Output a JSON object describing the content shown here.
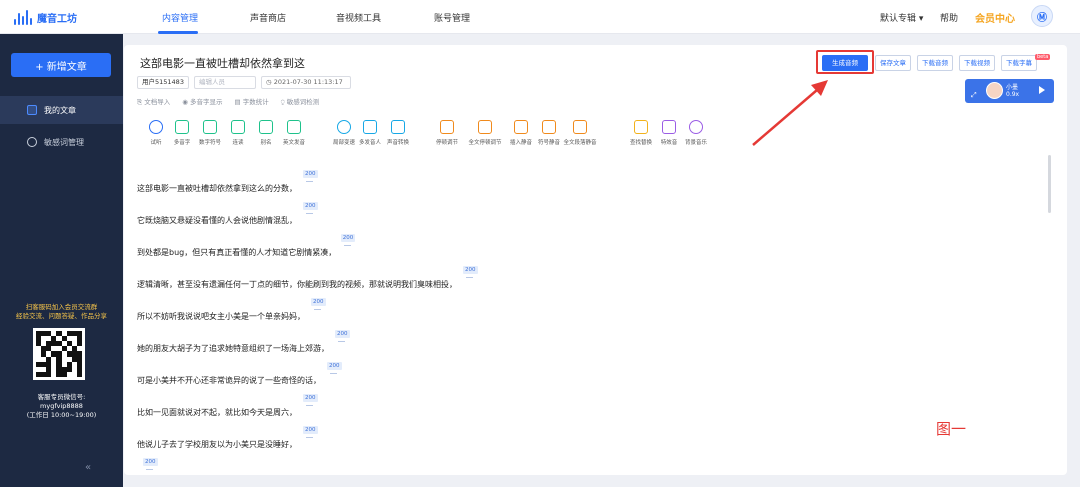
{
  "app": {
    "logo_text": "魔音工坊"
  },
  "nav": [
    "内容管理",
    "声音商店",
    "音视频工具",
    "账号管理"
  ],
  "topbar": {
    "album": "默认专辑 ▾",
    "help": "帮助",
    "vip": "会员中心",
    "avatar_text": "Ⓜ"
  },
  "sidebar": {
    "new_article": "+ 新增文章",
    "items": [
      "我的文章",
      "敏感词管理"
    ],
    "promo": "扫客服码加入会员交流群\n经验交流、问题答疑、作品分享",
    "service": "客服专员微信号:\nmygfvip8888\n(工作日 10:00~19:00)",
    "collapse": "«"
  },
  "doc": {
    "title": "这部电影一直被吐槽却依然拿到这",
    "user": "用户5151483",
    "editor_placeholder": "编辑人员",
    "date": "2021-07-30 11:13:17",
    "small_tools": [
      "文档导入",
      "多音字显示",
      "字数统计",
      "敏感词检测"
    ]
  },
  "buttons": [
    "生成音频",
    "保存文章",
    "下载音频",
    "下载视频",
    "下载字幕"
  ],
  "beta_badge": "beta",
  "voice": {
    "name": "小墨",
    "speed": "0.9x"
  },
  "tools": [
    {
      "label": "试听",
      "color": "#2a6ef5",
      "round": true
    },
    {
      "label": "多音字",
      "color": "#1ec28b",
      "round": false
    },
    {
      "label": "数字符号",
      "color": "#1ec28b",
      "round": false
    },
    {
      "label": "连读",
      "color": "#1ec28b",
      "round": false
    },
    {
      "label": "别名",
      "color": "#1ec28b",
      "round": false
    },
    {
      "label": "英文发音",
      "color": "#1ec28b",
      "round": false
    },
    {
      "label": "局部变速",
      "color": "#17a8e6",
      "round": true
    },
    {
      "label": "多发音人",
      "color": "#17a8e6",
      "round": false
    },
    {
      "label": "声音转换",
      "color": "#17a8e6",
      "round": false
    },
    {
      "label": "停顿调节",
      "color": "#f08a1c",
      "round": false
    },
    {
      "label": "全文停顿调节",
      "color": "#f08a1c",
      "round": false
    },
    {
      "label": "插入静音",
      "color": "#f08a1c",
      "round": false
    },
    {
      "label": "符号静音",
      "color": "#f08a1c",
      "round": false
    },
    {
      "label": "全文段落静音",
      "color": "#f08a1c",
      "round": false
    },
    {
      "label": "查找替换",
      "color": "#f2b21c",
      "round": false
    },
    {
      "label": "特效音",
      "color": "#9b5de5",
      "round": false
    },
    {
      "label": "背景音乐",
      "color": "#9b5de5",
      "round": true
    }
  ],
  "paragraphs": [
    {
      "text": "这部电影一直被吐槽却依然拿到这么的分数，",
      "pause": "200"
    },
    {
      "text": "它既烧脑又悬疑没看懂的人会说他剧情混乱，",
      "pause": "200"
    },
    {
      "text": "到处都是bug，但只有真正看懂的人才知道它剧情紧凑，",
      "pause": "200"
    },
    {
      "text": "逻辑清晰，甚至没有遗漏任何一丁点的细节，你能刷到我的视频，那就说明我们臭味相投，",
      "pause": "200"
    },
    {
      "text": "所以不妨听我说说吧女主小美是一个单亲妈妈，",
      "pause": "200"
    },
    {
      "text": "她的朋友大胡子为了追求她特意组织了一场海上郊游，",
      "pause": "200"
    },
    {
      "text": "可是小美并不开心还非常诡异的说了一些奇怪的话，",
      "pause": "200"
    },
    {
      "text": "比如一见面就说对不起，就比如今天是周六，",
      "pause": "200"
    },
    {
      "text": "他说儿子去了学校朋友以为小美只是没睡好，",
      "pause": "200"
    },
    {
      "text": "",
      "pause": "200"
    }
  ],
  "figure_label": "图一",
  "colors": {
    "accent": "#2a6ef5",
    "sidebar": "#1d2942",
    "annotation": "#e53935"
  }
}
